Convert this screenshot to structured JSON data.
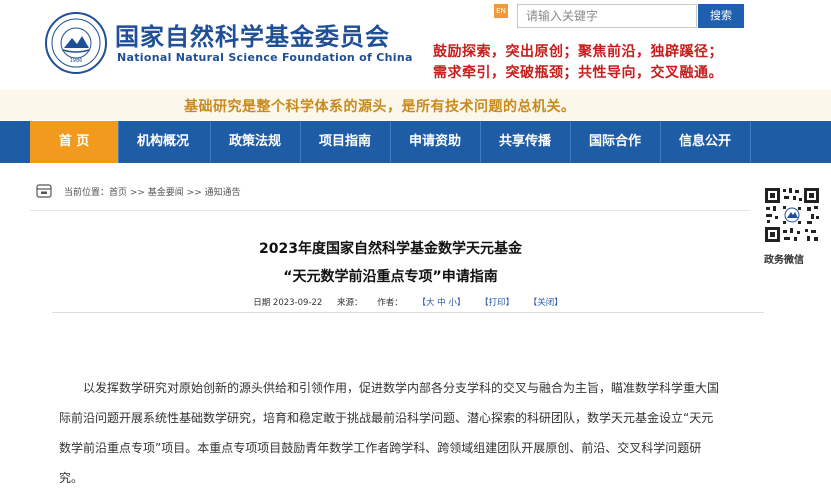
{
  "header": {
    "title": "国家自然科学基金委员会",
    "subtitle": "National Natural Science Foundation of China",
    "logo_year": "1986",
    "en_label": "EN",
    "search_placeholder": "请输入关键字",
    "search_button": "搜索",
    "slogan_line1": "鼓励探索，突出原创；聚焦前沿，独辟蹊径；",
    "slogan_line2": "需求牵引，突破瓶颈；共性导向，交叉融通。",
    "slogan_color": "#c71d1d"
  },
  "tagline": "基础研究是整个科学体系的源头，是所有技术问题的总机关。",
  "nav": {
    "items": [
      {
        "label": "首 页"
      },
      {
        "label": "机构概况"
      },
      {
        "label": "政策法规"
      },
      {
        "label": "项目指南"
      },
      {
        "label": "申请资助"
      },
      {
        "label": "共享传播"
      },
      {
        "label": "国际合作"
      },
      {
        "label": "信息公开"
      }
    ],
    "active_index": 0,
    "bg_color": "#1e5ca6",
    "active_color": "#f29a1d"
  },
  "breadcrumb": {
    "text": "当前位置：首页 >> 基金要闻 >> 通知通告"
  },
  "side": {
    "qr_label": "政务微信"
  },
  "article": {
    "title_line1": "2023年度国家自然科学基金数学天元基金",
    "title_line2": "“天元数学前沿重点专项”申请指南",
    "date": "日期 2023-09-22",
    "source": "来源：",
    "author": "作者：",
    "font_size": "【大 中 小】",
    "print": "【打印】",
    "close": "【关闭】",
    "paragraph": "以发挥数学研究对原始创新的源头供给和引领作用，促进数学内部各分支学科的交叉与融合为主旨，瞄准数学科学重大国际前沿问题开展系统性基础数学研究，培育和稳定敢于挑战最前沿科学问题、潜心探索的科研团队，数学天元基金设立“天元数学前沿重点专项”项目。本重点专项项目鼓励青年数学工作者跨学科、跨领域组建团队开展原创、前沿、交叉科学问题研究。"
  }
}
